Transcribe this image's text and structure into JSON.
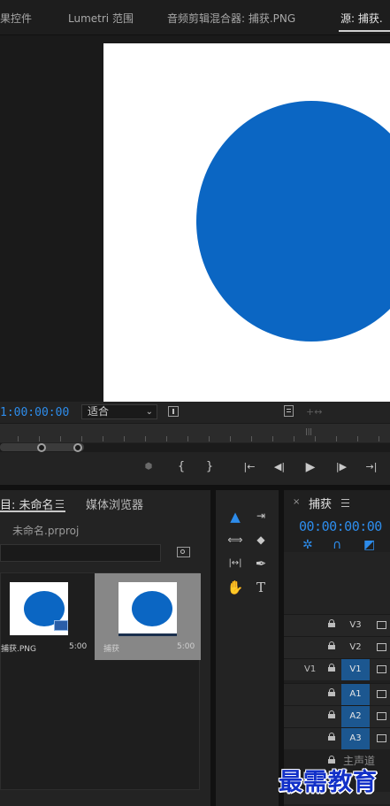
{
  "tabs": [
    {
      "label": "果控件",
      "active": false
    },
    {
      "label": "Lumetri 范围",
      "active": false
    },
    {
      "label": "音频剪辑混合器: 捕获.PNG",
      "active": false
    },
    {
      "label": "源: 捕获.",
      "active": true
    }
  ],
  "monitor": {
    "timecode": "1:00:00:00",
    "fit_value": "适合",
    "ruler_marker": "|||"
  },
  "transport": {
    "marker": "⬢",
    "mark_in": "{",
    "mark_out": "}",
    "go_to_in": "|←",
    "step_back": "◀|",
    "play": "▶",
    "step_forward": "|▶",
    "go_to_out": "→|"
  },
  "project": {
    "tab_project": "目: 未命名",
    "tab_media_browser": "媒体浏览器",
    "project_file": "未命名.prproj",
    "items": [
      {
        "name": "捕获.PNG",
        "duration": "5:00"
      },
      {
        "name": "捕获",
        "duration": "5:00"
      }
    ]
  },
  "tools": {
    "selection": "▲",
    "track_select": "⇥",
    "ripple_edit": "⟺",
    "razor": "◆",
    "slip": "|↔|",
    "pen": "✒",
    "hand": "✋",
    "type": "T"
  },
  "timeline": {
    "close": "×",
    "sequence_name": "捕获",
    "timecode": "00:00:00:00",
    "tracks": [
      {
        "source": "",
        "name": "V3",
        "on": false
      },
      {
        "source": "",
        "name": "V2",
        "on": false
      },
      {
        "source": "V1",
        "name": "V1",
        "on": true
      },
      {
        "source": "",
        "name": "A1",
        "on": true
      },
      {
        "source": "",
        "name": "A2",
        "on": true
      },
      {
        "source": "",
        "name": "A3",
        "on": true
      }
    ],
    "master_label": "主声道"
  },
  "watermark": "最需教育",
  "colors": {
    "accent_blue": "#2d8ceb",
    "ellipse_blue": "#0b66c3",
    "track_on": "#1c5790"
  }
}
